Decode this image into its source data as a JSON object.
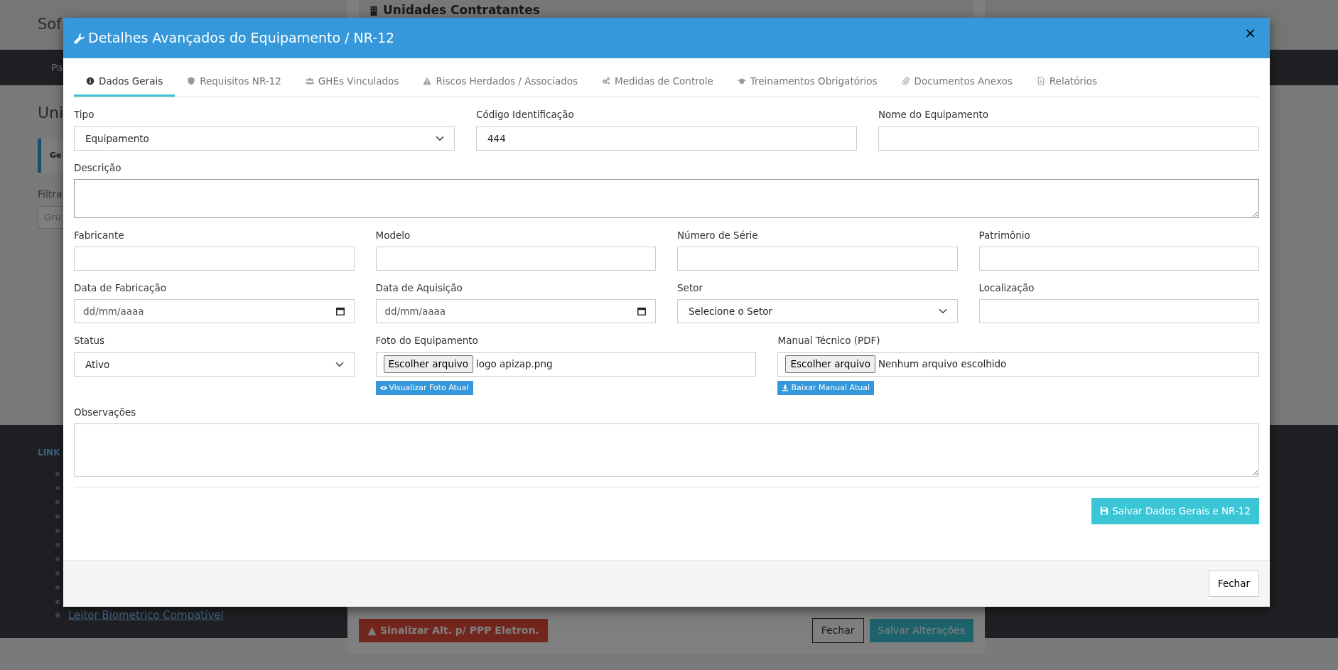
{
  "background": {
    "app_title": "Sof",
    "nav_item": "Pa",
    "page_title": "Uni",
    "tab": "Ge",
    "filter_label": "Filtra",
    "filter_field": "Gru",
    "links_heading": "LINK",
    "link": "Leitor Biometrico Compatível"
  },
  "back_modal": {
    "title": "Unidades Contratantes",
    "buttons": [
      {
        "label": "Sinalizar Alt. p/ PPP Eletron.",
        "kind": "danger"
      },
      {
        "label": "Fechar",
        "kind": "outline"
      },
      {
        "label": "Salvar Alterações",
        "kind": "info"
      }
    ]
  },
  "modal": {
    "title": "Detalhes Avançados do Equipamento / NR-12",
    "close_glyph": "×",
    "tabs": [
      {
        "label": "Dados Gerais",
        "selected": true
      },
      {
        "label": "Requisitos NR-12",
        "selected": false
      },
      {
        "label": "GHEs Vinculados",
        "selected": false
      },
      {
        "label": "Riscos Herdados / Associados",
        "selected": false
      },
      {
        "label": "Medidas de Controle",
        "selected": false
      },
      {
        "label": "Treinamentos Obrigatórios",
        "selected": false
      },
      {
        "label": "Documentos Anexos",
        "selected": false
      },
      {
        "label": "Relatórios",
        "selected": false
      }
    ],
    "rows": [
      [
        {
          "label": "Tipo",
          "kind": "select",
          "value": "Equipamento"
        },
        {
          "label": "Código Identificação",
          "kind": "text",
          "value": "444"
        },
        {
          "label": "Nome do Equipamento",
          "kind": "text"
        }
      ],
      [
        {
          "label": "Descrição",
          "kind": "textarea",
          "focused": true
        }
      ],
      [
        {
          "label": "Fabricante",
          "kind": "text"
        },
        {
          "label": "Modelo",
          "kind": "text"
        },
        {
          "label": "Número de Série",
          "kind": "text"
        },
        {
          "label": "Patrimônio",
          "kind": "text"
        }
      ],
      [
        {
          "label": "Data de Fabricação",
          "kind": "date",
          "placeholder": "dd/mm/aaaa"
        },
        {
          "label": "Data de Aquisição",
          "kind": "date",
          "placeholder": "dd/mm/aaaa"
        },
        {
          "label": "Setor",
          "kind": "select",
          "value": "Selecione o Setor"
        },
        {
          "label": "Localização",
          "kind": "text"
        }
      ],
      [
        {
          "label": "Status",
          "kind": "select",
          "value": "Ativo"
        },
        {
          "label": "Foto do Equipamento",
          "kind": "file",
          "button_label": "Escolher arquivo",
          "file_name": "logo apizap.png",
          "action": "Visualizar Foto Atual"
        },
        {
          "label": "Manual Técnico (PDF)",
          "kind": "file",
          "button_label": "Escolher arquivo",
          "file_name": "Nenhum arquivo escolhido",
          "action": "Baixar Manual Atual"
        }
      ],
      [
        {
          "label": "Observações",
          "kind": "textarea",
          "focused": false
        }
      ]
    ],
    "save_button": "Salvar Dados Gerais e NR-12",
    "footer_button": "Fechar"
  }
}
